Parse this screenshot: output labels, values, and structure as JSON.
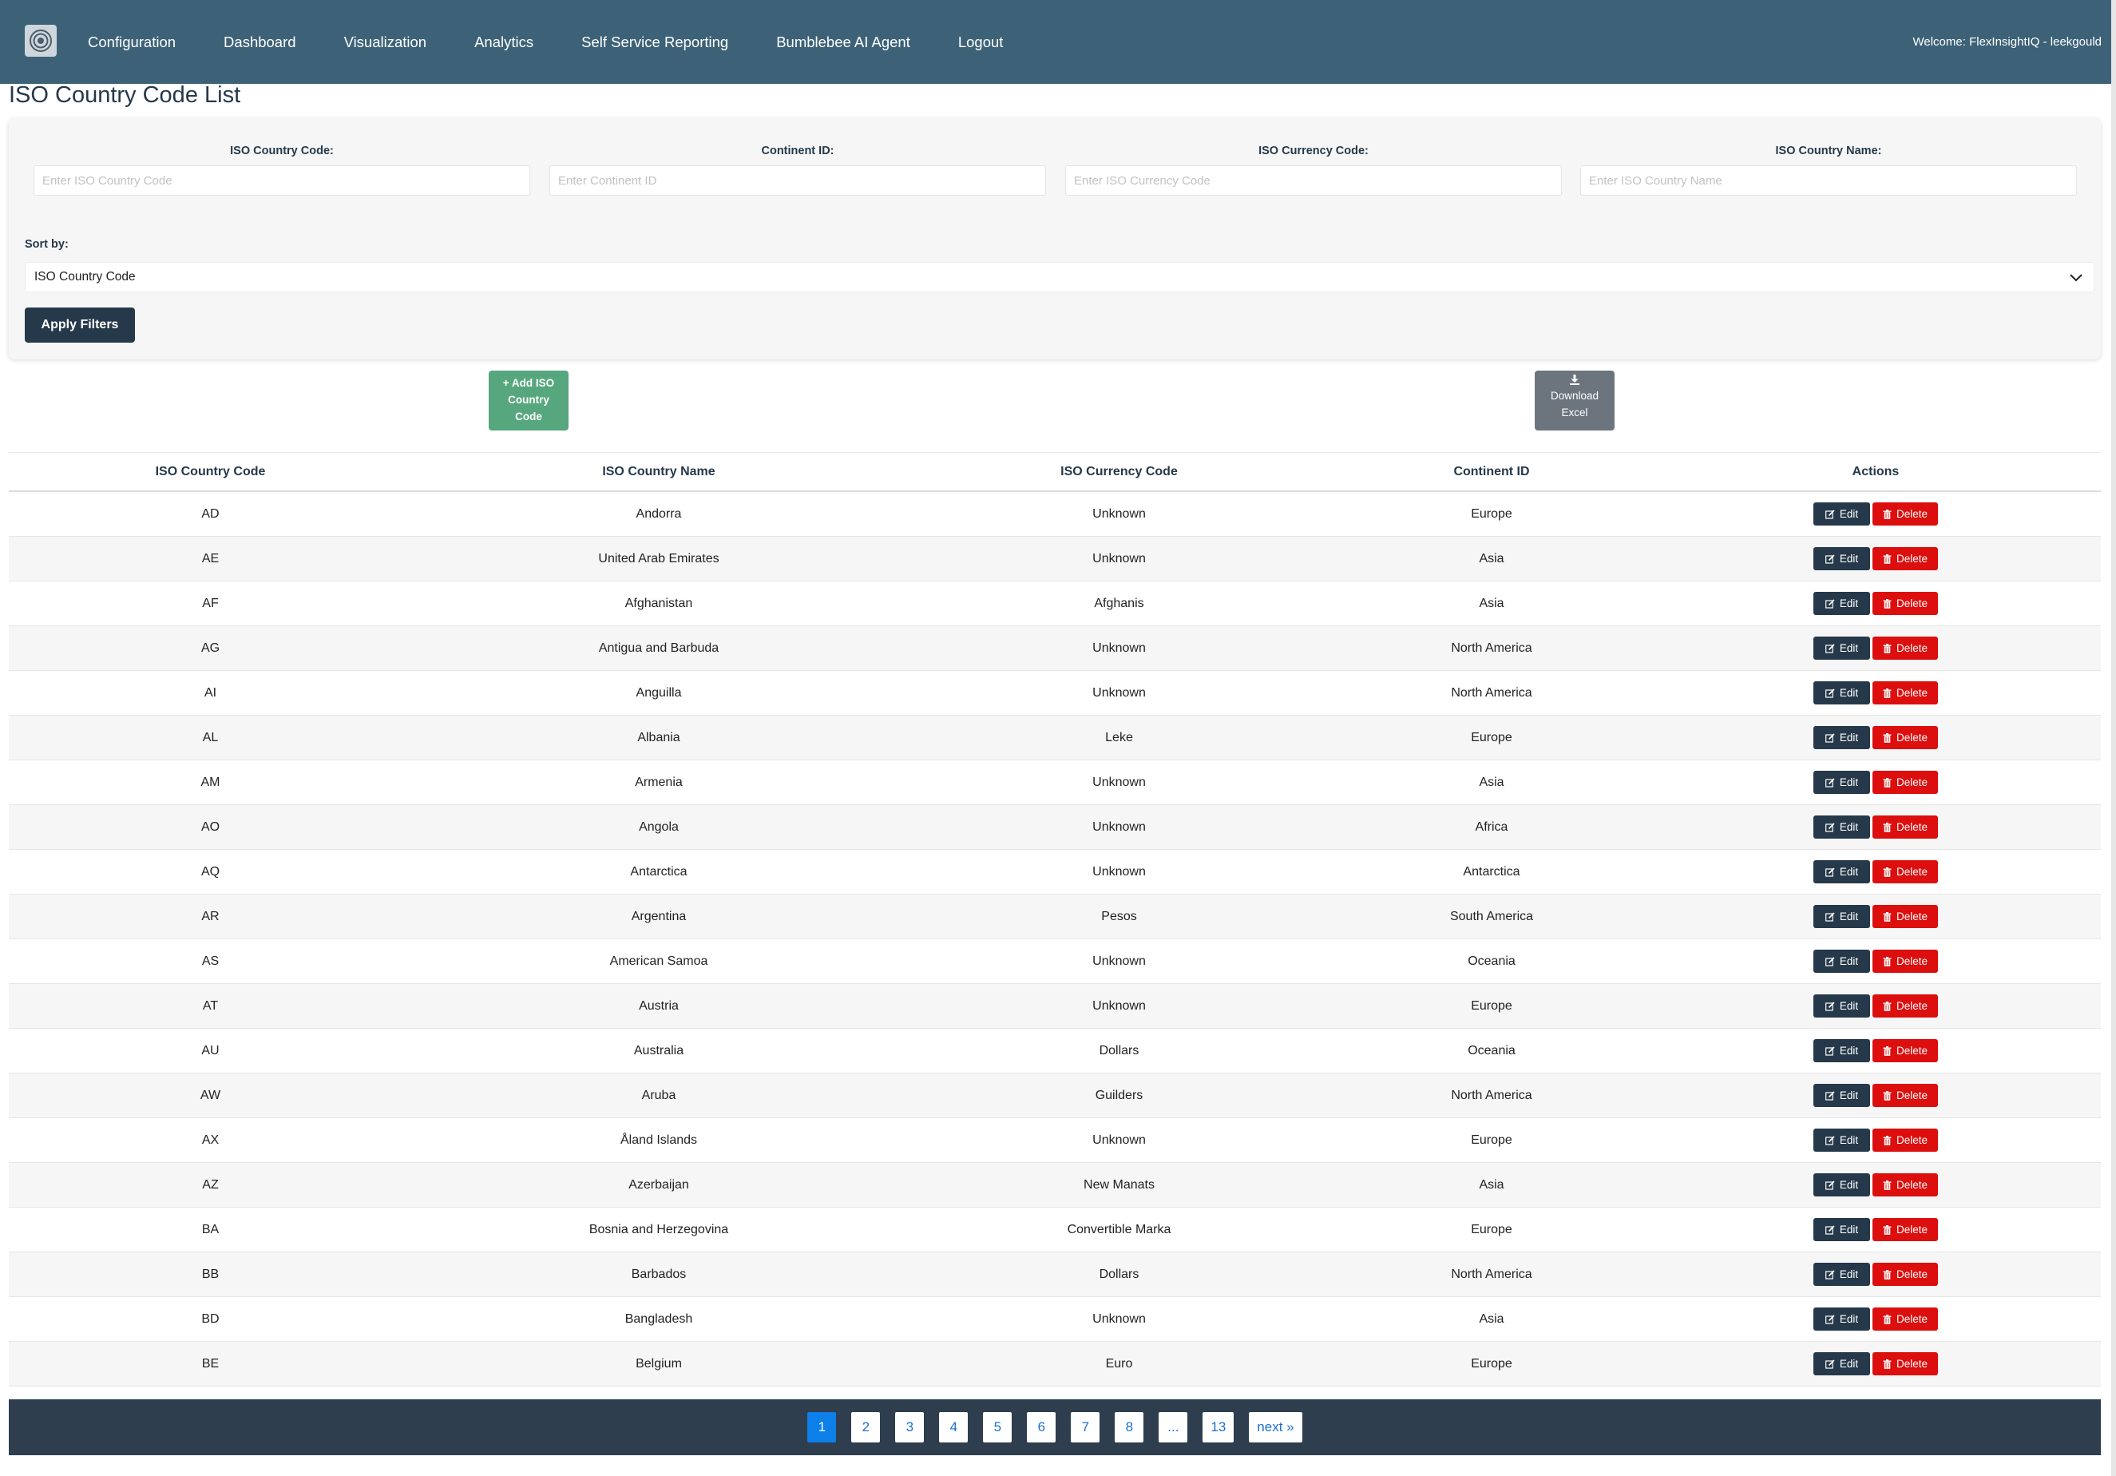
{
  "navbar": {
    "links": [
      "Configuration",
      "Dashboard",
      "Visualization",
      "Analytics",
      "Self Service Reporting",
      "Bumblebee AI Agent",
      "Logout"
    ],
    "welcome": "Welcome: FlexInsightIQ - leekgould"
  },
  "page": {
    "title": "ISO Country Code List"
  },
  "filters": {
    "fields": [
      {
        "label": "ISO Country Code:",
        "placeholder": "Enter ISO Country Code",
        "value": ""
      },
      {
        "label": "Continent ID:",
        "placeholder": "Enter Continent ID",
        "value": ""
      },
      {
        "label": "ISO Currency Code:",
        "placeholder": "Enter ISO Currency Code",
        "value": ""
      },
      {
        "label": "ISO Country Name:",
        "placeholder": "Enter ISO Country Name",
        "value": ""
      }
    ],
    "sort_label": "Sort by:",
    "sort_value": "ISO Country Code",
    "apply_label": "Apply Filters"
  },
  "actions": {
    "add_label_lines": [
      "+ Add ISO",
      "Country",
      "Code"
    ],
    "download_label_lines": [
      "Download",
      "Excel"
    ]
  },
  "table": {
    "headers": [
      "ISO Country Code",
      "ISO Country Name",
      "ISO Currency Code",
      "Continent ID",
      "Actions"
    ],
    "edit_label": "Edit",
    "delete_label": "Delete",
    "rows": [
      [
        "AD",
        "Andorra",
        "Unknown",
        "Europe"
      ],
      [
        "AE",
        "United Arab Emirates",
        "Unknown",
        "Asia"
      ],
      [
        "AF",
        "Afghanistan",
        "Afghanis",
        "Asia"
      ],
      [
        "AG",
        "Antigua and Barbuda",
        "Unknown",
        "North America"
      ],
      [
        "AI",
        "Anguilla",
        "Unknown",
        "North America"
      ],
      [
        "AL",
        "Albania",
        "Leke",
        "Europe"
      ],
      [
        "AM",
        "Armenia",
        "Unknown",
        "Asia"
      ],
      [
        "AO",
        "Angola",
        "Unknown",
        "Africa"
      ],
      [
        "AQ",
        "Antarctica",
        "Unknown",
        "Antarctica"
      ],
      [
        "AR",
        "Argentina",
        "Pesos",
        "South America"
      ],
      [
        "AS",
        "American Samoa",
        "Unknown",
        "Oceania"
      ],
      [
        "AT",
        "Austria",
        "Unknown",
        "Europe"
      ],
      [
        "AU",
        "Australia",
        "Dollars",
        "Oceania"
      ],
      [
        "AW",
        "Aruba",
        "Guilders",
        "North America"
      ],
      [
        "AX",
        "Åland Islands",
        "Unknown",
        "Europe"
      ],
      [
        "AZ",
        "Azerbaijan",
        "New Manats",
        "Asia"
      ],
      [
        "BA",
        "Bosnia and Herzegovina",
        "Convertible Marka",
        "Europe"
      ],
      [
        "BB",
        "Barbados",
        "Dollars",
        "North America"
      ],
      [
        "BD",
        "Bangladesh",
        "Unknown",
        "Asia"
      ],
      [
        "BE",
        "Belgium",
        "Euro",
        "Europe"
      ]
    ]
  },
  "pagination": {
    "pages": [
      "1",
      "2",
      "3",
      "4",
      "5",
      "6",
      "7",
      "8",
      "...",
      "13",
      "next »"
    ],
    "current": "1"
  },
  "colors": {
    "navbar": "#3d6278",
    "dark": "#25394a",
    "add_button": "#56a77d",
    "download_button": "#6c757d",
    "delete_button": "#dc0e0e",
    "pager_bg": "#2e3e4f",
    "pager_active": "#0d7fe8"
  },
  "icons": {
    "logo": "target-logo-icon",
    "sort": "chevron-down-icon",
    "download": "download-icon",
    "edit": "pencil-square-icon",
    "delete": "trash-icon"
  }
}
